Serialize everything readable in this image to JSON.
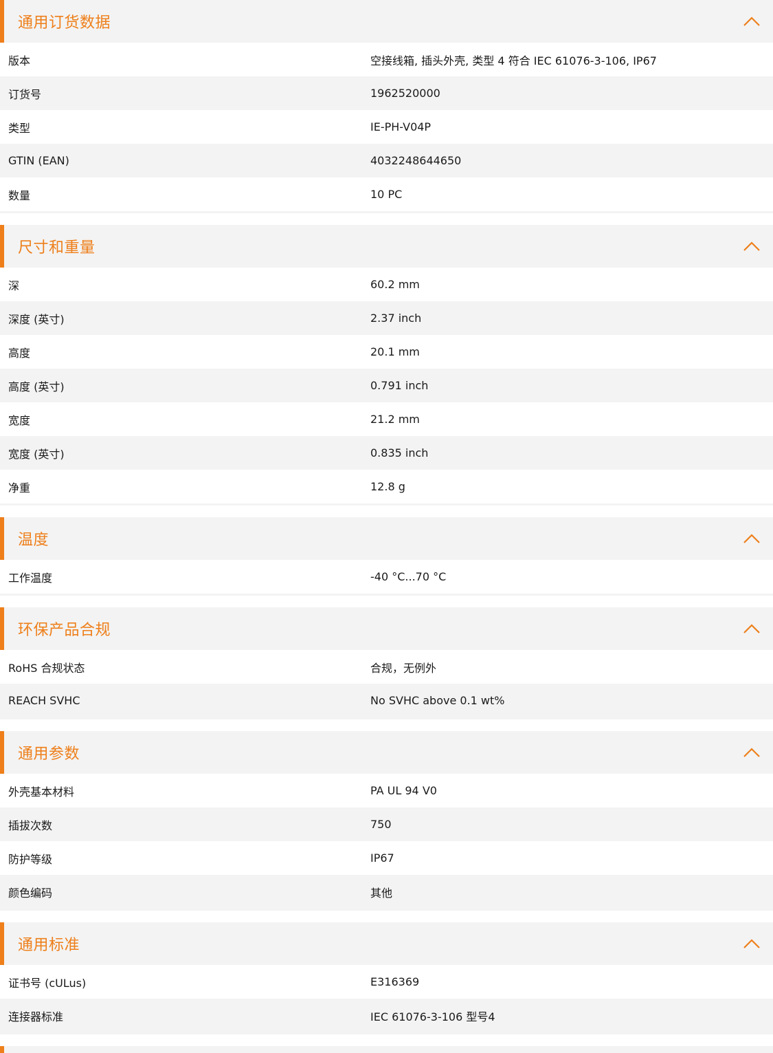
{
  "accent_color": "#ee7f1a",
  "collapse_icon": "chevron-up-icon",
  "sections": [
    {
      "title": "通用订货数据",
      "rows": [
        {
          "label": "版本",
          "value": "空接线箱, 插头外壳, 类型 4 符合 IEC 61076-3-106, IP67"
        },
        {
          "label": "订货号",
          "value": "1962520000"
        },
        {
          "label": "类型",
          "value": "IE-PH-V04P"
        },
        {
          "label": "GTIN (EAN)",
          "value": "4032248644650"
        },
        {
          "label": "数量",
          "value": "10  PC"
        }
      ]
    },
    {
      "title": "尺寸和重量",
      "rows": [
        {
          "label": "深",
          "value": "60.2  mm"
        },
        {
          "label": "深度 (英寸)",
          "value": "2.37  inch"
        },
        {
          "label": "高度",
          "value": "20.1  mm"
        },
        {
          "label": "高度 (英寸)",
          "value": "0.791  inch"
        },
        {
          "label": "宽度",
          "value": "21.2  mm"
        },
        {
          "label": "宽度 (英寸)",
          "value": "0.835  inch"
        },
        {
          "label": "净重",
          "value": "12.8  g"
        }
      ]
    },
    {
      "title": "温度",
      "rows": [
        {
          "label": "工作温度",
          "value": "-40 °C...70 °C"
        }
      ]
    },
    {
      "title": "环保产品合规",
      "rows": [
        {
          "label": "RoHS 合规状态",
          "value": "合规，无例外"
        },
        {
          "label": "REACH SVHC",
          "value": "No SVHC above 0.1 wt%"
        }
      ]
    },
    {
      "title": "通用参数",
      "rows": [
        {
          "label": "外壳基本材料",
          "value": "PA UL 94 V0"
        },
        {
          "label": "插拔次数",
          "value": "750"
        },
        {
          "label": "防护等级",
          "value": "IP67"
        },
        {
          "label": "颜色编码",
          "value": "其他"
        }
      ]
    },
    {
      "title": "通用标准",
      "rows": [
        {
          "label": "证书号 (cULus)",
          "value": "E316369"
        },
        {
          "label": "连接器标准",
          "value": "IEC 61076-3-106 型号4"
        }
      ]
    }
  ]
}
